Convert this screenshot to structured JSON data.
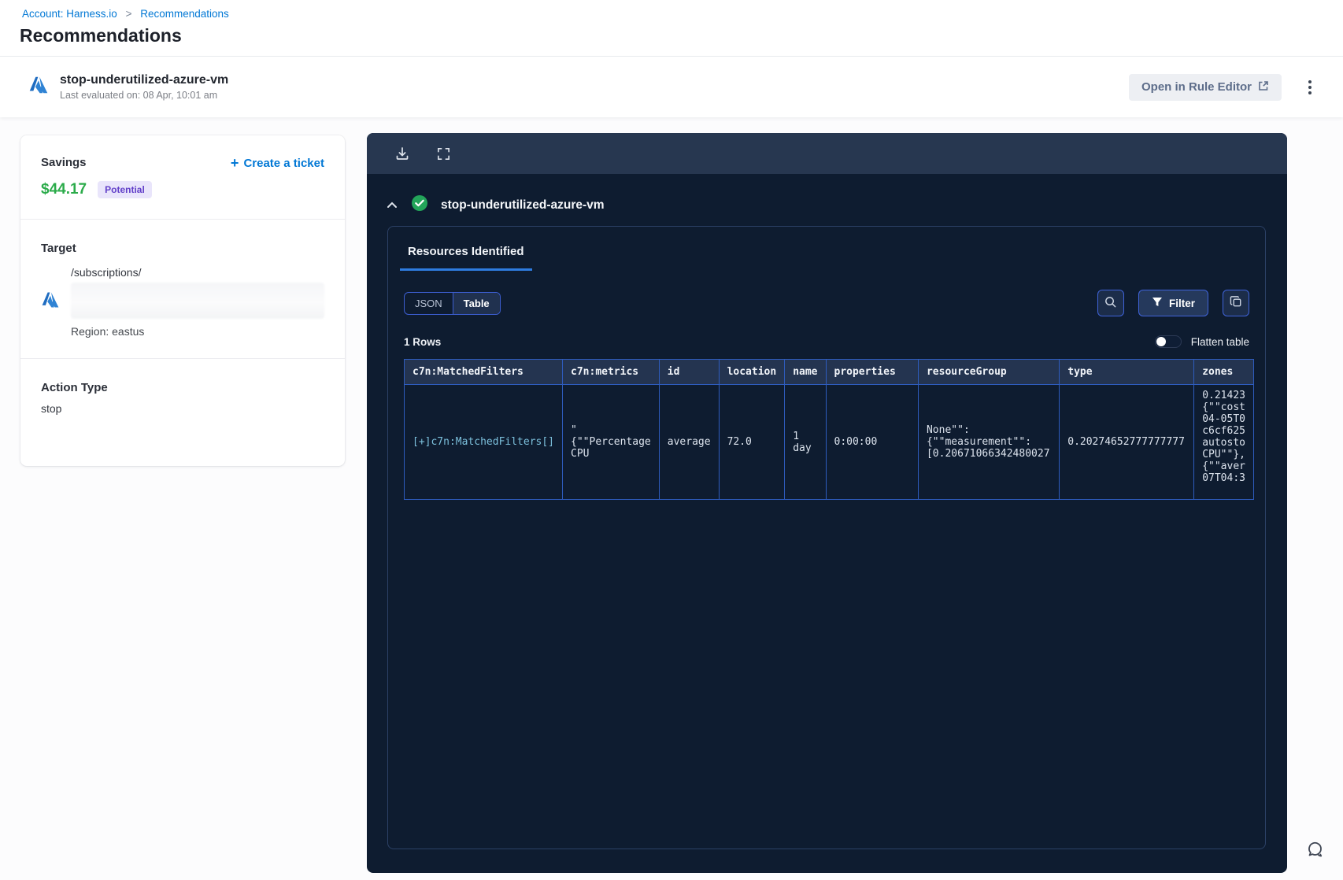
{
  "breadcrumb": {
    "account": "Account: Harness.io",
    "separator": ">",
    "current": "Recommendations"
  },
  "page": {
    "title": "Recommendations"
  },
  "header": {
    "title": "stop-underutilized-azure-vm",
    "subtitle": "Last evaluated on: 08 Apr, 10:01 am",
    "open_rule_editor_label": "Open in Rule Editor"
  },
  "savings": {
    "label": "Savings",
    "amount": "$44.17",
    "badge": "Potential",
    "create_ticket_label": "Create a ticket"
  },
  "target": {
    "label": "Target",
    "path": "/subscriptions/",
    "region": "Region: eastus"
  },
  "action_type": {
    "label": "Action Type",
    "value": "stop"
  },
  "panel": {
    "title": "stop-underutilized-azure-vm",
    "tab_label": "Resources Identified",
    "view_toggle": {
      "json": "JSON",
      "table": "Table",
      "selected": "Table"
    },
    "filter_label": "Filter",
    "rows_count": "1 Rows",
    "flatten_label": "Flatten table",
    "flatten_enabled": false
  },
  "table": {
    "columns": [
      "c7n:MatchedFilters",
      "c7n:metrics",
      "id",
      "location",
      "name",
      "properties",
      "resourceGroup",
      "type",
      "zones"
    ],
    "row": {
      "matched_filters": "[+]c7n:MatchedFilters[]",
      "metrics": "\"\n{\"\"Percentage\nCPU",
      "id": "average",
      "location": "72.0",
      "name": "1\nday",
      "properties": "0:00:00",
      "resource_group": "None\"\":\n{\"\"measurement\"\":\n[0.20671066342480027",
      "type": "0.20274652777777777",
      "zones": "0.21423\n{\"\"cost\n04-05T0\nc6cf625\nautosto\nCPU\"\"},\n{\"\"aver\n07T04:3"
    }
  },
  "colors": {
    "accent_blue": "#0278d5",
    "panel_bg": "#0e1c30",
    "table_border": "#2e5cbe",
    "savings_green": "#2bab4a",
    "badge_purple": "#6240c9",
    "success_green": "#23a55a",
    "tab_underline": "#2e7ce0"
  }
}
